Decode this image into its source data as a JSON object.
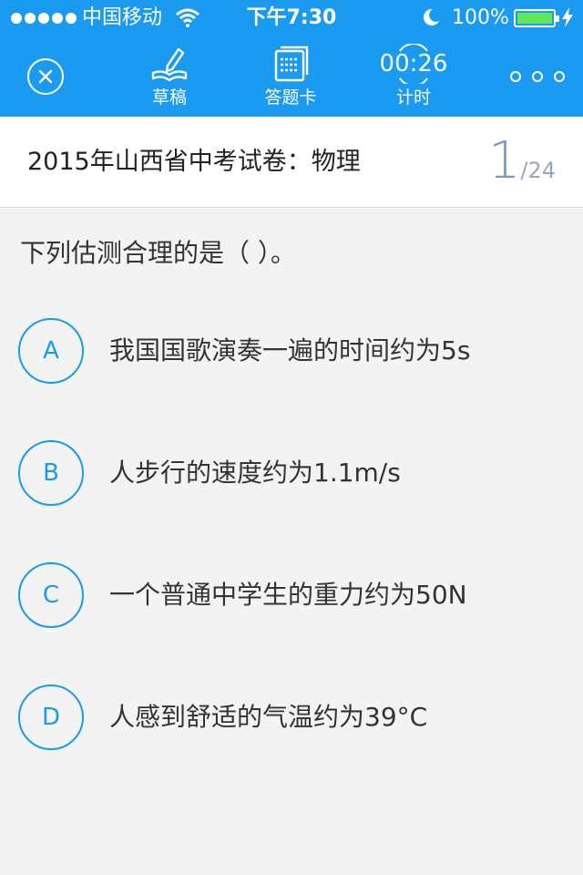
{
  "status_bar": {
    "carrier": "中国移动",
    "time": "下午7:30",
    "battery": "100%"
  },
  "toolbar": {
    "draft_label": "草稿",
    "answer_card_label": "答题卡",
    "timer_value": "00:26",
    "timer_label": "计时"
  },
  "exam": {
    "title": "2015年山西省中考试卷：物理",
    "current_question": "1",
    "total_questions": "/24"
  },
  "question": {
    "stem": "下列估测合理的是（  ）。",
    "options": [
      {
        "letter": "A",
        "text": "我国国歌演奏一遍的时间约为5s"
      },
      {
        "letter": "B",
        "text": "人步行的速度约为1.1m/s"
      },
      {
        "letter": "C",
        "text": "一个普通中学生的重力约为50N"
      },
      {
        "letter": "D",
        "text": "人感到舒适的气温约为39°C"
      }
    ]
  },
  "colors": {
    "accent": "#1a9af0",
    "battery_fill": "#5fe65a",
    "page_counter": "#7f96c7",
    "background": "#f3f3f3"
  },
  "icons": [
    "close-icon",
    "pencil-book-icon",
    "answer-card-icon",
    "stopwatch-icon",
    "more-icon",
    "wifi-icon",
    "moon-icon",
    "battery-icon",
    "charging-bolt-icon"
  ]
}
